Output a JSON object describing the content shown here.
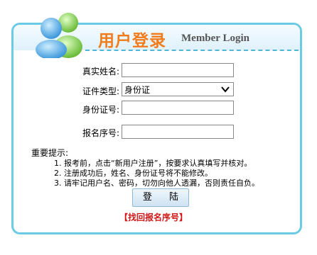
{
  "header": {
    "title_cn": "用户登录",
    "title_en": "Member Login",
    "mascot_icon": "two-users-icon"
  },
  "form": {
    "real_name_label": "真实姓名:",
    "real_name_value": "",
    "id_type_label": "证件类型:",
    "id_type_selected": "身份证",
    "id_number_label": "身份证号:",
    "id_number_value": "",
    "reg_number_label": "报名序号:",
    "reg_number_value": ""
  },
  "notes": {
    "title": "重要提示:",
    "items": [
      "1. 报考前，点击“新用户注册”，按要求认真填写并核对。",
      "2. 注册成功后，姓名、身份证号将不能修改。",
      "3. 请牢记用户名、密码，切勿向他人透漏，否则责任自负。"
    ]
  },
  "actions": {
    "login_label": "登 陆",
    "recover_link": "【找回报名序号】"
  },
  "colors": {
    "panel_border": "#6ccbe4",
    "title_orange": "#f27b1b",
    "link_red": "#d01818"
  }
}
